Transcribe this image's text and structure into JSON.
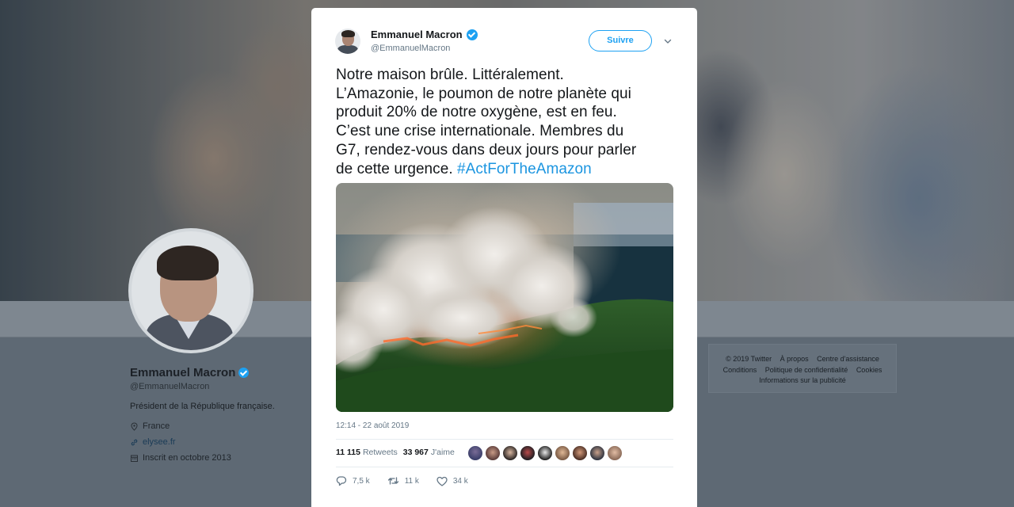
{
  "profile": {
    "name": "Emmanuel Macron",
    "handle": "@EmmanuelMacron",
    "bio": "Président de la République française.",
    "location": "France",
    "website": "elysee.fr",
    "joined": "Inscrit en octobre 2013"
  },
  "footer": {
    "row1": [
      "© 2019 Twitter",
      "À propos",
      "Centre d'assistance"
    ],
    "row2": [
      "Conditions",
      "Politique de confidentialité",
      "Cookies"
    ],
    "row3": [
      "Informations sur la publicité"
    ]
  },
  "tweet": {
    "author_name": "Emmanuel Macron",
    "author_handle": "@EmmanuelMacron",
    "follow_label": "Suivre",
    "text_lines": [
      "Notre maison brûle. Littéralement.",
      "L’Amazonie, le poumon de notre planète qui",
      "produit 20% de notre oxygène, est en feu.",
      "C’est une crise internationale. Membres du",
      "G7, rendez-vous dans deux jours pour parler",
      "de cette urgence. "
    ],
    "hashtag": "#ActForTheAmazon",
    "timestamp": "12:14 - 22 août 2019",
    "retweets_count": "11 115",
    "retweets_label": "Retweets",
    "likes_count": "33 967",
    "likes_label": "J'aime",
    "reply_count": "7,5 k",
    "retweet_action_count": "11 k",
    "like_action_count": "34 k"
  },
  "colors": {
    "accent": "#1da1f2",
    "hashtag": "#1b95e0",
    "muted": "#657786"
  },
  "icons": [
    "verified-badge-icon",
    "chevron-down-icon",
    "location-pin-icon",
    "link-icon",
    "calendar-icon",
    "reply-icon",
    "retweet-icon",
    "heart-icon"
  ]
}
